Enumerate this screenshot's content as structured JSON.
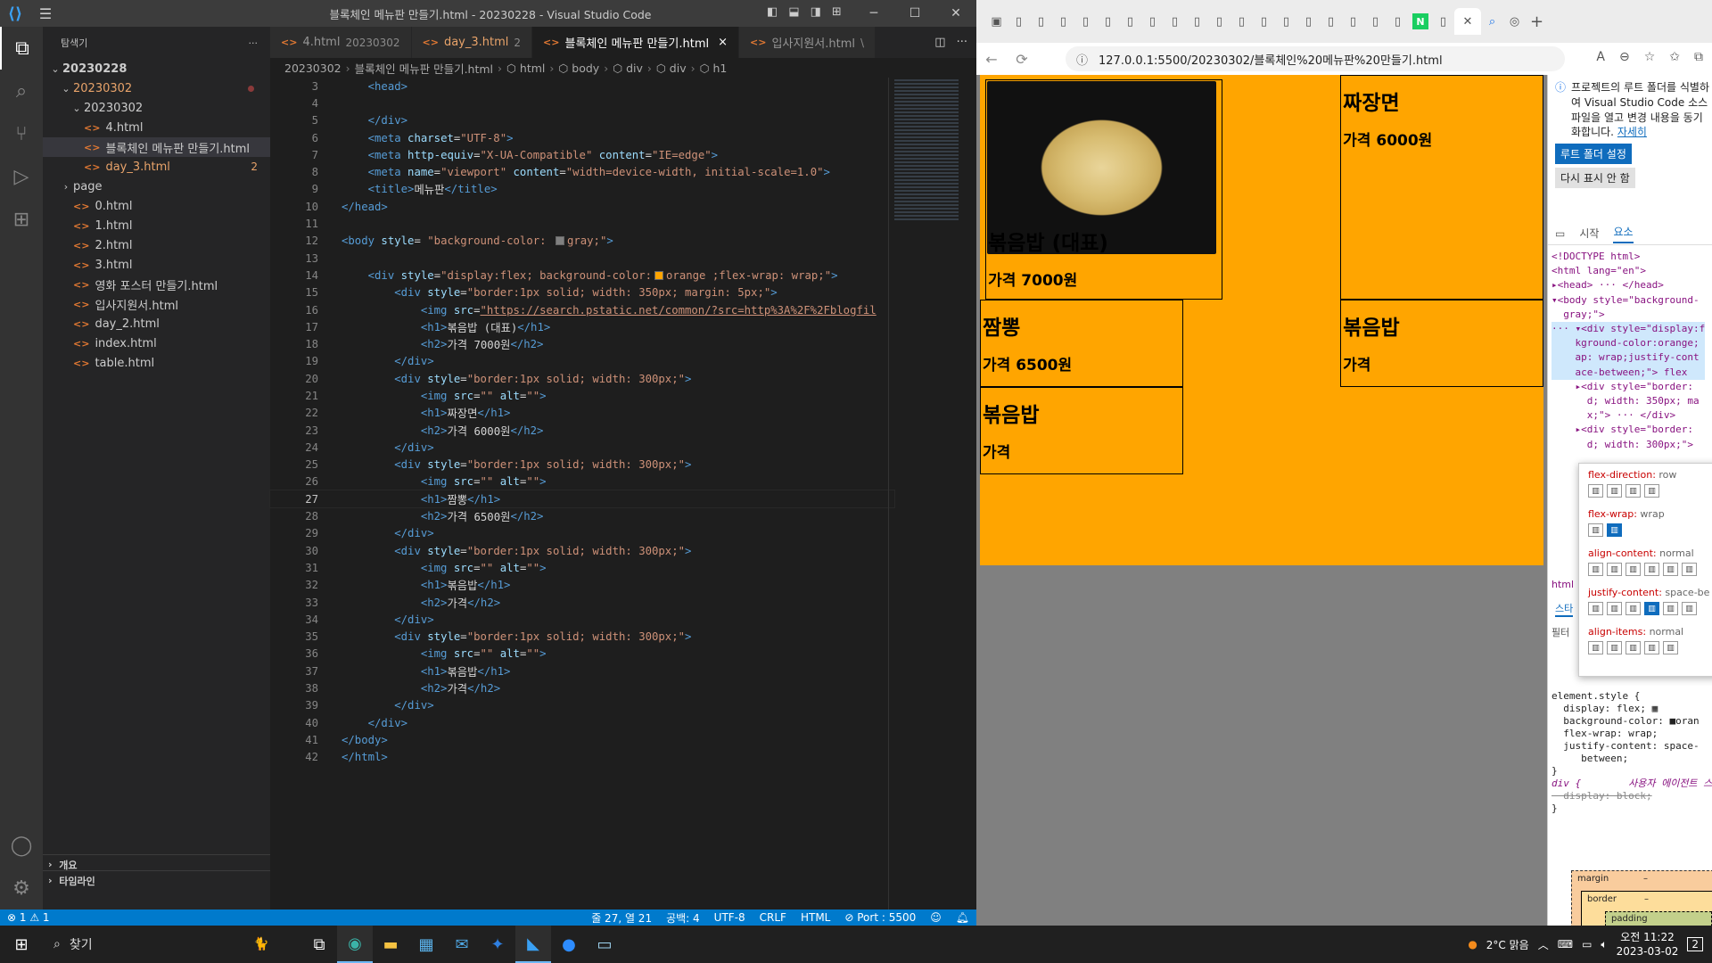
{
  "vscode": {
    "title": "블록체인 메뉴판 만들기.html - 20230228 - Visual Studio Code",
    "explorer_title": "탐색기",
    "more": "···",
    "tree": [
      {
        "label": "20230228",
        "depth": 0,
        "type": "folder-open",
        "bold": true
      },
      {
        "label": "20230302",
        "depth": 1,
        "type": "folder-open",
        "mod": true,
        "dot": true
      },
      {
        "label": "20230302",
        "depth": 2,
        "type": "folder-open"
      },
      {
        "label": "4.html",
        "depth": 2,
        "type": "file"
      },
      {
        "label": "블록체인 메뉴판 만들기.html",
        "depth": 2,
        "type": "file",
        "selected": true
      },
      {
        "label": "day_3.html",
        "depth": 2,
        "type": "file",
        "mod": true,
        "badge": "2"
      },
      {
        "label": "page",
        "depth": 1,
        "type": "folder"
      },
      {
        "label": "0.html",
        "depth": 1,
        "type": "file"
      },
      {
        "label": "1.html",
        "depth": 1,
        "type": "file"
      },
      {
        "label": "2.html",
        "depth": 1,
        "type": "file"
      },
      {
        "label": "3.html",
        "depth": 1,
        "type": "file"
      },
      {
        "label": "영화 포스터 만들기.html",
        "depth": 1,
        "type": "file"
      },
      {
        "label": "입사지원서.html",
        "depth": 1,
        "type": "file"
      },
      {
        "label": "day_2.html",
        "depth": 1,
        "type": "file"
      },
      {
        "label": "index.html",
        "depth": 1,
        "type": "file"
      },
      {
        "label": "table.html",
        "depth": 1,
        "type": "file"
      }
    ],
    "outline": "개요",
    "timeline": "타임라인",
    "tabs": [
      {
        "label": "4.html",
        "sub": "20230302"
      },
      {
        "label": "day_3.html",
        "sub": "2",
        "mod": true
      },
      {
        "label": "블록체인 메뉴판 만들기.html",
        "active": true,
        "close": "×"
      },
      {
        "label": "입사지원서.html",
        "sub": "\\"
      }
    ],
    "breadcrumbs": [
      "20230302",
      "블록체인 메뉴판 만들기.html",
      "html",
      "body",
      "div",
      "div",
      "h1"
    ],
    "status": {
      "errors": "⊗ 1 ⚠ 1",
      "position": "줄 27, 열 21",
      "spaces": "공백: 4",
      "encoding": "UTF-8",
      "eol": "CRLF",
      "lang": "HTML",
      "port": "⊘ Port : 5500"
    }
  },
  "code": [
    {
      "n": "3",
      "parts": [
        [
          "pu",
          "    "
        ],
        [
          "tg",
          "<head>"
        ]
      ]
    },
    {
      "n": "4",
      "parts": [
        [
          "pu",
          ""
        ]
      ]
    },
    {
      "n": "5",
      "parts": [
        [
          "pu",
          "    "
        ],
        [
          "tg",
          "</div>"
        ]
      ]
    },
    {
      "n": "6",
      "parts": [
        [
          "pu",
          "    "
        ],
        [
          "tg",
          "<meta "
        ],
        [
          "at",
          "charset"
        ],
        [
          "tx",
          "="
        ],
        [
          "st",
          "\"UTF-8\""
        ],
        [
          "tg",
          ">"
        ]
      ]
    },
    {
      "n": "7",
      "parts": [
        [
          "pu",
          "    "
        ],
        [
          "tg",
          "<meta "
        ],
        [
          "at",
          "http-equiv"
        ],
        [
          "tx",
          "="
        ],
        [
          "st",
          "\"X-UA-Compatible\""
        ],
        [
          "at",
          " content"
        ],
        [
          "tx",
          "="
        ],
        [
          "st",
          "\"IE=edge\""
        ],
        [
          "tg",
          ">"
        ]
      ]
    },
    {
      "n": "8",
      "parts": [
        [
          "pu",
          "    "
        ],
        [
          "tg",
          "<meta "
        ],
        [
          "at",
          "name"
        ],
        [
          "tx",
          "="
        ],
        [
          "st",
          "\"viewport\""
        ],
        [
          "at",
          " content"
        ],
        [
          "tx",
          "="
        ],
        [
          "st",
          "\"width=device-width, initial-scale=1.0\""
        ],
        [
          "tg",
          ">"
        ]
      ]
    },
    {
      "n": "9",
      "parts": [
        [
          "pu",
          "    "
        ],
        [
          "tg",
          "<title>"
        ],
        [
          "tx",
          "메뉴판"
        ],
        [
          "tg",
          "</title>"
        ]
      ]
    },
    {
      "n": "10",
      "parts": [
        [
          "tg",
          "</head>"
        ]
      ]
    },
    {
      "n": "11",
      "parts": [
        [
          "pu",
          ""
        ]
      ]
    },
    {
      "n": "12",
      "parts": [
        [
          "tg",
          "<body "
        ],
        [
          "at",
          "style"
        ],
        [
          "tx",
          "= "
        ],
        [
          "st",
          "\"background-color: "
        ],
        [
          "sw",
          "#808080"
        ],
        [
          "st",
          "gray;\""
        ],
        [
          "tg",
          ">"
        ]
      ]
    },
    {
      "n": "13",
      "parts": [
        [
          "pu",
          ""
        ]
      ]
    },
    {
      "n": "14",
      "parts": [
        [
          "pu",
          "    "
        ],
        [
          "tg",
          "<div "
        ],
        [
          "at",
          "style"
        ],
        [
          "tx",
          "="
        ],
        [
          "st",
          "\"display:flex; background-color:"
        ],
        [
          "sw",
          "#ffa500"
        ],
        [
          "st",
          "orange ;flex-wrap: wrap;\""
        ],
        [
          "tg",
          ">"
        ]
      ]
    },
    {
      "n": "15",
      "parts": [
        [
          "pu",
          "        "
        ],
        [
          "tg",
          "<div "
        ],
        [
          "at",
          "style"
        ],
        [
          "tx",
          "="
        ],
        [
          "st",
          "\"border:1px solid; width: 350px; margin: 5px;\""
        ],
        [
          "tg",
          ">"
        ]
      ]
    },
    {
      "n": "16",
      "parts": [
        [
          "pu",
          "            "
        ],
        [
          "tg",
          "<img "
        ],
        [
          "at",
          "src"
        ],
        [
          "tx",
          "="
        ],
        [
          "ul",
          "\"https://search.pstatic.net/common/?src=http%3A%2F%2Fblogfil"
        ]
      ]
    },
    {
      "n": "17",
      "parts": [
        [
          "pu",
          "            "
        ],
        [
          "tg",
          "<h1>"
        ],
        [
          "tx",
          "볶음밥 (대표)"
        ],
        [
          "tg",
          "</h1>"
        ]
      ]
    },
    {
      "n": "18",
      "parts": [
        [
          "pu",
          "            "
        ],
        [
          "tg",
          "<h2>"
        ],
        [
          "tx",
          "가격 7000원"
        ],
        [
          "tg",
          "</h2>"
        ]
      ]
    },
    {
      "n": "19",
      "parts": [
        [
          "pu",
          "        "
        ],
        [
          "tg",
          "</div>"
        ]
      ]
    },
    {
      "n": "20",
      "parts": [
        [
          "pu",
          "        "
        ],
        [
          "tg",
          "<div "
        ],
        [
          "at",
          "style"
        ],
        [
          "tx",
          "="
        ],
        [
          "st",
          "\"border:1px solid; width: 300px;\""
        ],
        [
          "tg",
          ">"
        ]
      ]
    },
    {
      "n": "21",
      "parts": [
        [
          "pu",
          "            "
        ],
        [
          "tg",
          "<img "
        ],
        [
          "at",
          "src"
        ],
        [
          "tx",
          "="
        ],
        [
          "st",
          "\"\""
        ],
        [
          "at",
          " alt"
        ],
        [
          "tx",
          "="
        ],
        [
          "st",
          "\"\""
        ],
        [
          "tg",
          ">"
        ]
      ]
    },
    {
      "n": "22",
      "parts": [
        [
          "pu",
          "            "
        ],
        [
          "tg",
          "<h1>"
        ],
        [
          "tx",
          "짜장면"
        ],
        [
          "tg",
          "</h1>"
        ]
      ]
    },
    {
      "n": "23",
      "parts": [
        [
          "pu",
          "            "
        ],
        [
          "tg",
          "<h2>"
        ],
        [
          "tx",
          "가격 6000원"
        ],
        [
          "tg",
          "</h2>"
        ]
      ]
    },
    {
      "n": "24",
      "parts": [
        [
          "pu",
          "        "
        ],
        [
          "tg",
          "</div>"
        ]
      ]
    },
    {
      "n": "25",
      "parts": [
        [
          "pu",
          "        "
        ],
        [
          "tg",
          "<div "
        ],
        [
          "at",
          "style"
        ],
        [
          "tx",
          "="
        ],
        [
          "st",
          "\"border:1px solid; width: 300px;\""
        ],
        [
          "tg",
          ">"
        ]
      ]
    },
    {
      "n": "26",
      "parts": [
        [
          "pu",
          "            "
        ],
        [
          "tg",
          "<img "
        ],
        [
          "at",
          "src"
        ],
        [
          "tx",
          "="
        ],
        [
          "st",
          "\"\""
        ],
        [
          "at",
          " alt"
        ],
        [
          "tx",
          "="
        ],
        [
          "st",
          "\"\""
        ],
        [
          "tg",
          ">"
        ]
      ]
    },
    {
      "n": "27",
      "cur": true,
      "parts": [
        [
          "pu",
          "            "
        ],
        [
          "tg",
          "<h1>"
        ],
        [
          "tx",
          "짬뽕"
        ],
        [
          "tg",
          "</h1>"
        ]
      ]
    },
    {
      "n": "28",
      "parts": [
        [
          "pu",
          "            "
        ],
        [
          "tg",
          "<h2>"
        ],
        [
          "tx",
          "가격 6500원"
        ],
        [
          "tg",
          "</h2>"
        ]
      ]
    },
    {
      "n": "29",
      "parts": [
        [
          "pu",
          "        "
        ],
        [
          "tg",
          "</div>"
        ]
      ]
    },
    {
      "n": "30",
      "parts": [
        [
          "pu",
          "        "
        ],
        [
          "tg",
          "<div "
        ],
        [
          "at",
          "style"
        ],
        [
          "tx",
          "="
        ],
        [
          "st",
          "\"border:1px solid; width: 300px;\""
        ],
        [
          "tg",
          ">"
        ]
      ]
    },
    {
      "n": "31",
      "parts": [
        [
          "pu",
          "            "
        ],
        [
          "tg",
          "<img "
        ],
        [
          "at",
          "src"
        ],
        [
          "tx",
          "="
        ],
        [
          "st",
          "\"\""
        ],
        [
          "at",
          " alt"
        ],
        [
          "tx",
          "="
        ],
        [
          "st",
          "\"\""
        ],
        [
          "tg",
          ">"
        ]
      ]
    },
    {
      "n": "32",
      "parts": [
        [
          "pu",
          "            "
        ],
        [
          "tg",
          "<h1>"
        ],
        [
          "tx",
          "볶음밥"
        ],
        [
          "tg",
          "</h1>"
        ]
      ]
    },
    {
      "n": "33",
      "parts": [
        [
          "pu",
          "            "
        ],
        [
          "tg",
          "<h2>"
        ],
        [
          "tx",
          "가격"
        ],
        [
          "tg",
          "</h2>"
        ]
      ]
    },
    {
      "n": "34",
      "parts": [
        [
          "pu",
          "        "
        ],
        [
          "tg",
          "</div>"
        ]
      ]
    },
    {
      "n": "35",
      "parts": [
        [
          "pu",
          "        "
        ],
        [
          "tg",
          "<div "
        ],
        [
          "at",
          "style"
        ],
        [
          "tx",
          "="
        ],
        [
          "st",
          "\"border:1px solid; width: 300px;\""
        ],
        [
          "tg",
          ">"
        ]
      ]
    },
    {
      "n": "36",
      "parts": [
        [
          "pu",
          "            "
        ],
        [
          "tg",
          "<img "
        ],
        [
          "at",
          "src"
        ],
        [
          "tx",
          "="
        ],
        [
          "st",
          "\"\""
        ],
        [
          "at",
          " alt"
        ],
        [
          "tx",
          "="
        ],
        [
          "st",
          "\"\""
        ],
        [
          "tg",
          ">"
        ]
      ]
    },
    {
      "n": "37",
      "parts": [
        [
          "pu",
          "            "
        ],
        [
          "tg",
          "<h1>"
        ],
        [
          "tx",
          "볶음밥"
        ],
        [
          "tg",
          "</h1>"
        ]
      ]
    },
    {
      "n": "38",
      "parts": [
        [
          "pu",
          "            "
        ],
        [
          "tg",
          "<h2>"
        ],
        [
          "tx",
          "가격"
        ],
        [
          "tg",
          "</h2>"
        ]
      ]
    },
    {
      "n": "39",
      "parts": [
        [
          "pu",
          "        "
        ],
        [
          "tg",
          "</div>"
        ]
      ]
    },
    {
      "n": "40",
      "parts": [
        [
          "pu",
          "    "
        ],
        [
          "tg",
          "</div>"
        ]
      ]
    },
    {
      "n": "41",
      "parts": [
        [
          "tg",
          "</body>"
        ]
      ]
    },
    {
      "n": "42",
      "parts": [
        [
          "tg",
          "</html>"
        ]
      ]
    }
  ],
  "browser": {
    "url": "127.0.0.1:5500/20230302/블록체인%20메뉴판%20만들기.html",
    "cards": [
      {
        "title": "볶음밥 (대표)",
        "price": "가격 7000원"
      },
      {
        "title": "짜장면",
        "price": "가격 6000원"
      },
      {
        "title": "짬뽕",
        "price": "가격 6500원"
      },
      {
        "title": "볶음밥",
        "price": "가격"
      },
      {
        "title": "볶음밥",
        "price": "가격"
      }
    ]
  },
  "devtools": {
    "info": "프로젝트의 루트 폴더를 식별하여 Visual Studio Code 소스 파일을 열고 변경 내용을 동기화합니다.",
    "more_link": "자세히",
    "btn_root": "루트 폴더 설정",
    "btn_hide": "다시 표시 안 함",
    "tab_start": "시작",
    "tab_elements": "요소",
    "dom": [
      "<!DOCTYPE html>",
      "<html lang=\"en\">",
      "▸<head> ··· </head>",
      "▾<body style=\"background-",
      "  gray;\">",
      "··· ▾<div style=\"display:f",
      "    kground-color:orange;",
      "    ap: wrap;justify-cont",
      "    ace-between;\"> flex",
      "    ▸<div style=\"border:",
      "      d; width: 350px; ma",
      "      x;\"> ··· </div>",
      "    ▸<div style=\"border:",
      "      d; width: 300px;\">"
    ],
    "fx": [
      {
        "k": "flex-direction:",
        "v": "row"
      },
      {
        "k": "flex-wrap:",
        "v": "wrap"
      },
      {
        "k": "align-content:",
        "v": "normal"
      },
      {
        "k": "justify-content:",
        "v": "space-be"
      },
      {
        "k": "align-items:",
        "v": "normal"
      }
    ],
    "html_crumb": "html",
    "styles_tab": "스타",
    "filter": "필터",
    "css": [
      "element.style {",
      "  display: flex; ▦",
      "  background-color: ■oran",
      "  flex-wrap: wrap;",
      "  justify-content: space-",
      "     between;",
      "}",
      "div {        사용자 에이전트 스",
      "  display: block;",
      "}"
    ],
    "box": {
      "margin": "margin",
      "border": "border",
      "padding": "padding",
      "dash": "–"
    }
  },
  "taskbar": {
    "search": "찾기",
    "weather": "2°C 맑음",
    "time": "오전 11:22",
    "date": "2023-03-02",
    "notif": "2"
  }
}
